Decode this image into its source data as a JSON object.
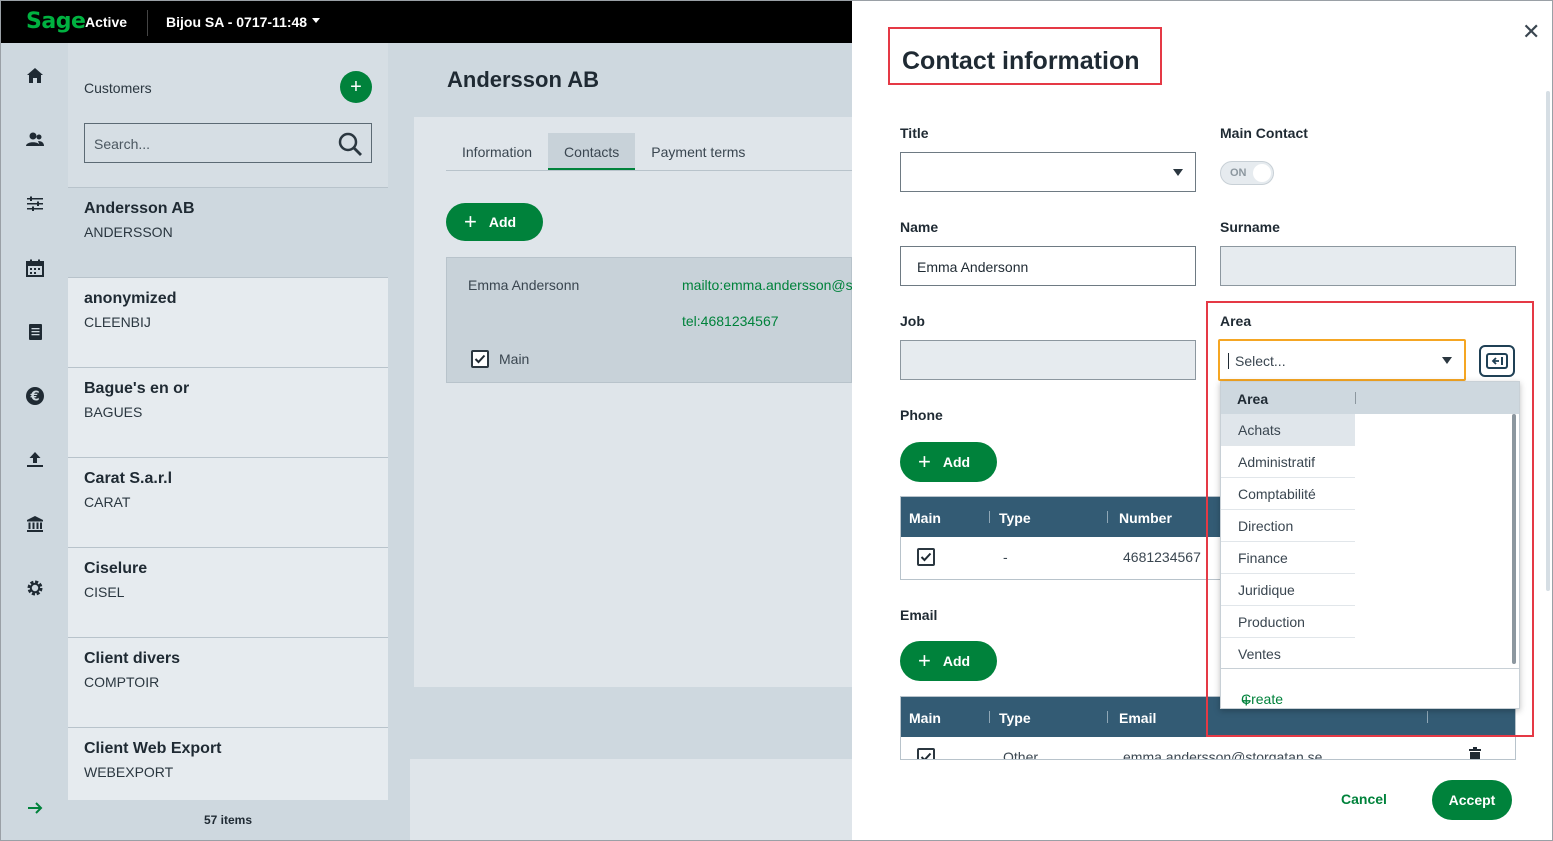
{
  "topbar": {
    "logo": "Sage",
    "status": "Active",
    "company": "Bijou SA - 0717-11:48"
  },
  "rail": {
    "icons": [
      "home-icon",
      "people-icon",
      "sliders-icon",
      "calendar-icon",
      "document-icon",
      "euro-icon",
      "upload-icon",
      "bank-icon",
      "gear-icon",
      "arrow-right-icon"
    ]
  },
  "customers": {
    "label": "Customers",
    "search_placeholder": "Search...",
    "items": [
      {
        "name": "Andersson AB",
        "code": "ANDERSSON"
      },
      {
        "name": "anonymized",
        "code": "CLEENBIJ"
      },
      {
        "name": "Bague's en or",
        "code": "BAGUES"
      },
      {
        "name": "Carat S.a.r.l",
        "code": "CARAT"
      },
      {
        "name": "Ciselure",
        "code": "CISEL"
      },
      {
        "name": "Client divers",
        "code": "COMPTOIR"
      },
      {
        "name": "Client Web Export",
        "code": "WEBEXPORT"
      }
    ],
    "count": "57 items"
  },
  "main": {
    "title": "Andersson AB",
    "tabs": [
      "Information",
      "Contacts",
      "Payment terms"
    ],
    "active_tab": "Contacts",
    "add_label": "Add",
    "contact": {
      "name": "Emma Andersonn",
      "email": "mailto:emma.andersson@st",
      "tel": "tel:4681234567",
      "main_label": "Main"
    }
  },
  "dialog": {
    "title": "Contact information",
    "fields": {
      "title_label": "Title",
      "main_contact_label": "Main Contact",
      "toggle": "ON",
      "name_label": "Name",
      "name_value": "Emma Andersonn",
      "surname_label": "Surname",
      "job_label": "Job",
      "area_label": "Area",
      "area_placeholder": "Select...",
      "phone_label": "Phone",
      "email_label": "Email"
    },
    "add_label": "Add",
    "dropdown": {
      "header": "Area",
      "items": [
        "Achats",
        "Administratif",
        "Comptabilité",
        "Direction",
        "Finance",
        "Juridique",
        "Production",
        "Ventes"
      ],
      "create": "Create"
    },
    "phone_table": {
      "headers": [
        "Main",
        "Type",
        "Number"
      ],
      "row": {
        "type": "-",
        "number": "4681234567"
      }
    },
    "email_table": {
      "headers": [
        "Main",
        "Type",
        "Email"
      ],
      "row": {
        "type": "Other",
        "email": "emma.andersson@storgatan.se"
      }
    },
    "cancel": "Cancel",
    "accept": "Accept"
  },
  "colors": {
    "brand_green": "#00823b",
    "highlight_red": "#e53945",
    "focus_orange": "#f5a623",
    "table_header": "#335b74"
  }
}
